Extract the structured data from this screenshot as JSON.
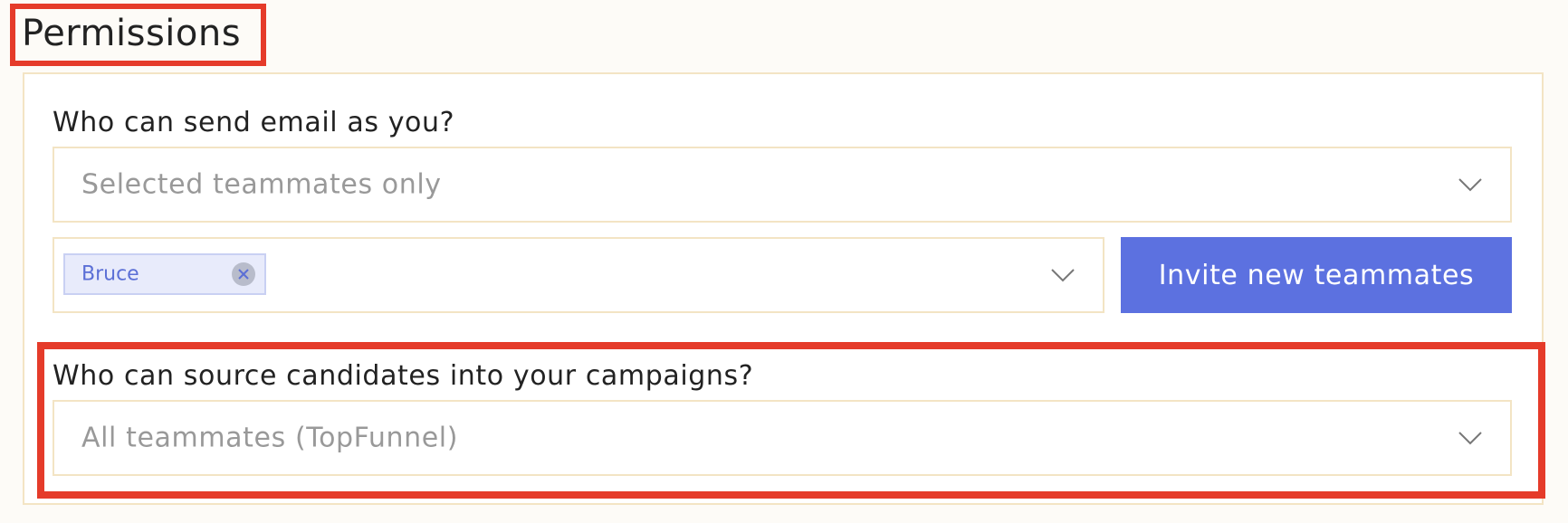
{
  "section": {
    "title": "Permissions"
  },
  "send_email": {
    "label": "Who can send email as you?",
    "selected_value": "Selected teammates only",
    "teammates": {
      "chips": [
        {
          "label": "Bruce"
        }
      ]
    },
    "invite_label": "Invite new teammates"
  },
  "source_candidates": {
    "label": "Who can source candidates into your campaigns?",
    "selected_value": "All teammates (TopFunnel)"
  },
  "colors": {
    "accent": "#5c71e0",
    "highlight": "#e53b2a",
    "field_border": "#f3e4c4",
    "chip_bg": "#e8ebfb"
  },
  "icons": {
    "dropdown": "chevron-down-icon",
    "chip_remove": "close-icon"
  }
}
